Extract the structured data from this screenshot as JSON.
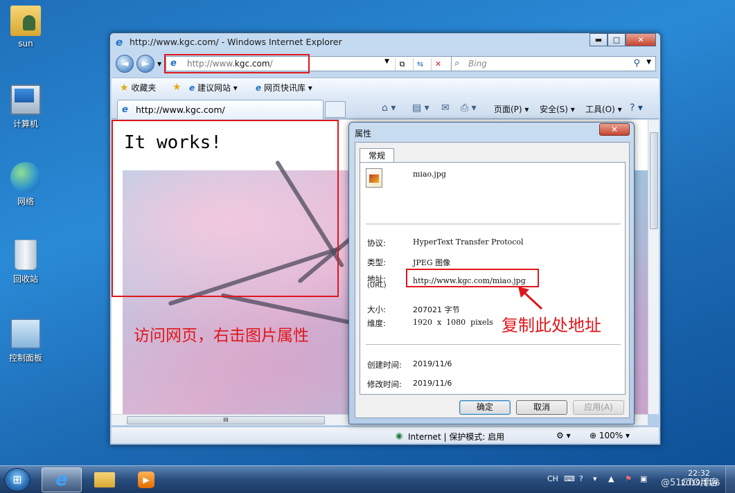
{
  "desktop": {
    "icons": [
      {
        "label": "sun",
        "icon": "user-folder-icon"
      },
      {
        "label": "计算机",
        "icon": "computer-icon"
      },
      {
        "label": "网络",
        "icon": "network-icon"
      },
      {
        "label": "回收站",
        "icon": "recycle-bin-icon"
      },
      {
        "label": "控制面板",
        "icon": "control-panel-icon"
      }
    ]
  },
  "ie": {
    "title": "http://www.kgc.com/ - Windows Internet Explorer",
    "window_buttons": {
      "minimize": "▬",
      "maximize": "□",
      "close": "✕"
    },
    "address": {
      "prefix": "http://www.",
      "domain": "kgc.com",
      "suffix": "/"
    },
    "search_placeholder": "Bing",
    "favorites": {
      "label": "收藏夹",
      "suggested": "建议网站",
      "webslice": "网页快讯库"
    },
    "tab_title": "http://www.kgc.com/",
    "commands": {
      "page": "页面(P)",
      "safety": "安全(S)",
      "tools": "工具(O)"
    },
    "page": {
      "heading": "It works!"
    },
    "annotation_left": "访问网页，右击图片属性",
    "status": {
      "zone": "Internet | 保护模式: 启用",
      "zoom": "100%"
    },
    "scroll_grip": "III"
  },
  "properties_dialog": {
    "title": "属性",
    "close": "✕",
    "tab": "常规",
    "filename": "miao.jpg",
    "rows": {
      "protocol_label": "协议:",
      "protocol_value": "HyperText Transfer Protocol",
      "type_label": "类型:",
      "type_value": "JPEG 图像",
      "address_label": "地址:",
      "address_sub": "(URL)",
      "address_value": "http://www.kgc.com/miao.jpg",
      "size_label": "大小:",
      "size_value": "207021 字节",
      "dimensions_label": "维度:",
      "dimensions_value": "1920  x  1080  pixels",
      "created_label": "创建时间:",
      "created_value": "2019/11/6",
      "modified_label": "修改时间:",
      "modified_value": "2019/11/6"
    },
    "buttons": {
      "ok": "确定",
      "cancel": "取消",
      "apply": "应用(A)"
    },
    "annotation": "复制此处地址"
  },
  "taskbar": {
    "lang": "CH",
    "time": "22:32",
    "date": "2019/11/6",
    "watermark": "@51CTO博客"
  },
  "colors": {
    "annotation_red": "#e0161a",
    "desktop_blue": "#2a8ad6"
  }
}
